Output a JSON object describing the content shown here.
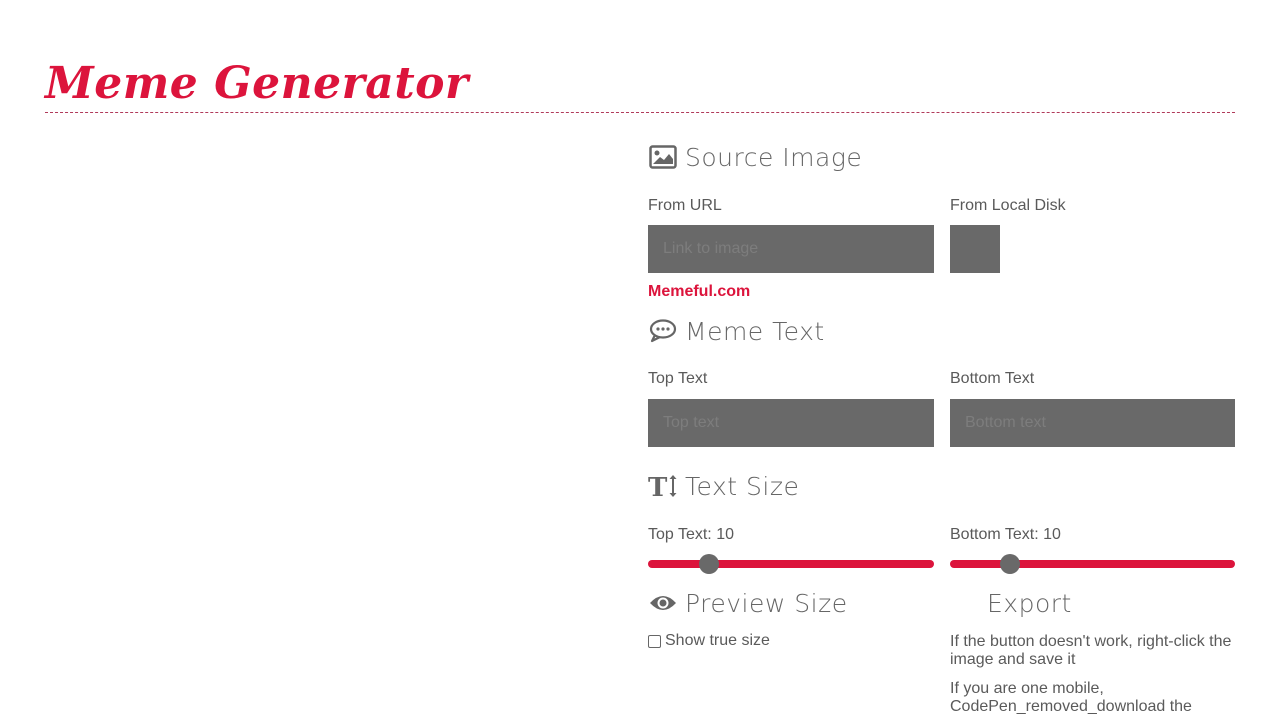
{
  "app": {
    "title": "Meme Generator",
    "accent_color": "#dc143c"
  },
  "source_image": {
    "heading": "Source Image",
    "icon": "image-icon",
    "from_url_label": "From URL",
    "url_input": {
      "value": "",
      "placeholder": "Link to image"
    },
    "from_disk_label": "From Local Disk",
    "link_text": "Memeful.com"
  },
  "meme_text": {
    "heading": "Meme Text",
    "icon": "speech-bubble-icon",
    "top_label": "Top Text",
    "top_input": {
      "value": "",
      "placeholder": "Top text"
    },
    "bottom_label": "Bottom Text",
    "bottom_input": {
      "value": "",
      "placeholder": "Bottom text"
    }
  },
  "text_size": {
    "heading": "Text Size",
    "icon": "text-height-icon",
    "top_label": "Top Text: 10",
    "top_value": 10,
    "top_fraction": 0.19,
    "bottom_label": "Bottom Text: 10",
    "bottom_value": 10,
    "bottom_fraction": 0.19
  },
  "preview_size": {
    "heading": "Preview Size",
    "icon": "eye-icon",
    "checkbox_label": "Show true size",
    "checked": false
  },
  "export": {
    "heading": "Export",
    "note_1": "If the button doesn't work, right-click the image and save it",
    "note_2": "If you are one mobile, CodePen_removed_download the"
  }
}
